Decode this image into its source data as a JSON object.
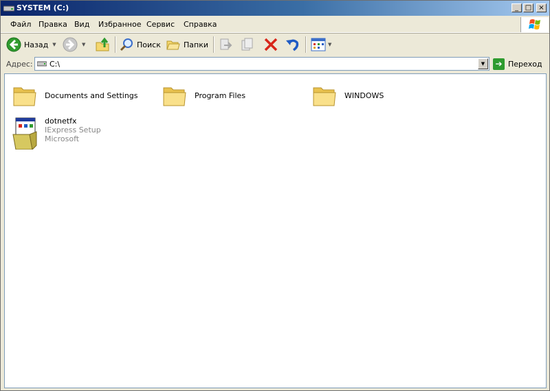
{
  "window": {
    "title": "SYSTEM (C:)",
    "controls": {
      "minimize": "_",
      "maximize": "□",
      "close": "×"
    }
  },
  "menu": {
    "items": [
      "Файл",
      "Правка",
      "Вид",
      "Избранное",
      "Сервис",
      "Справка"
    ]
  },
  "toolbar": {
    "back_label": "Назад",
    "search_label": "Поиск",
    "folders_label": "Папки"
  },
  "address": {
    "label": "Адрес:",
    "value": "C:\\",
    "go_label": "Переход"
  },
  "items": [
    {
      "name": "Documents and Settings",
      "type": "folder"
    },
    {
      "name": "Program Files",
      "type": "folder"
    },
    {
      "name": "WINDOWS",
      "type": "folder"
    }
  ],
  "file": {
    "name": "dotnetfx",
    "description": "IExpress Setup",
    "company": "Microsoft"
  },
  "colors": {
    "titlebar_start": "#0a246a",
    "titlebar_end": "#a6caf0",
    "folder": "#f5d76e",
    "delete_red": "#d8261a",
    "go_green": "#2f9b2f"
  }
}
